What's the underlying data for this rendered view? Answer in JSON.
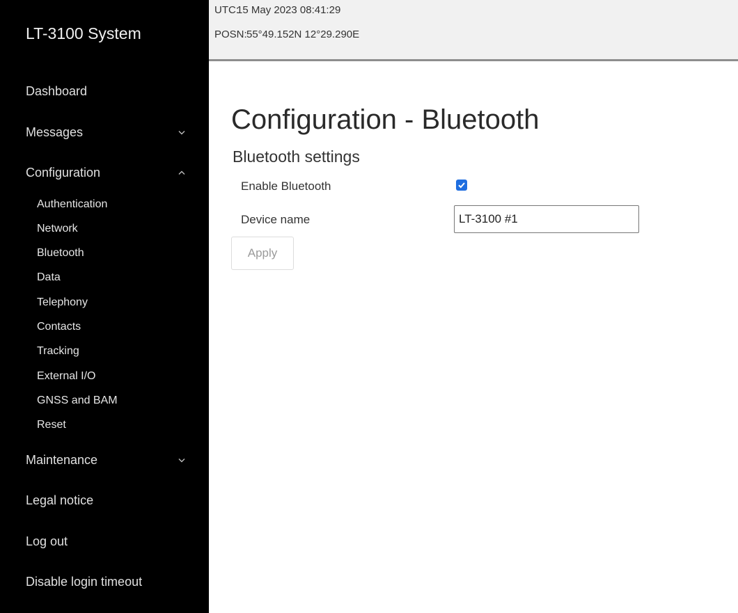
{
  "sidebar": {
    "brand": "LT-3100 System",
    "items": [
      {
        "label": "Dashboard"
      },
      {
        "label": "Messages",
        "chevron": "chevron-down-icon"
      },
      {
        "label": "Configuration",
        "chevron": "chevron-up-icon"
      },
      {
        "label": "Maintenance",
        "chevron": "chevron-down-icon"
      },
      {
        "label": "Legal notice"
      },
      {
        "label": "Log out"
      },
      {
        "label": "Disable login timeout"
      }
    ],
    "configuration_subitems": [
      "Authentication",
      "Network",
      "Bluetooth",
      "Data",
      "Telephony",
      "Contacts",
      "Tracking",
      "External I/O",
      "GNSS and BAM",
      "Reset"
    ]
  },
  "header": {
    "utc_label": "UTC:",
    "utc_value": "15 May 2023 08:41:29",
    "posn_label": "POSN:",
    "posn_value": "55°49.152N 12°29.290E"
  },
  "main": {
    "title": "Configuration - Bluetooth",
    "section_title": "Bluetooth settings",
    "enable_label": "Enable Bluetooth",
    "enable_checked": true,
    "device_name_label": "Device name",
    "device_name_value": "LT-3100 #1",
    "apply_label": "Apply"
  },
  "colors": {
    "sidebar_bg": "#000000",
    "header_bg": "#f1f1f1",
    "checkbox_accent": "#1f6ee0"
  }
}
